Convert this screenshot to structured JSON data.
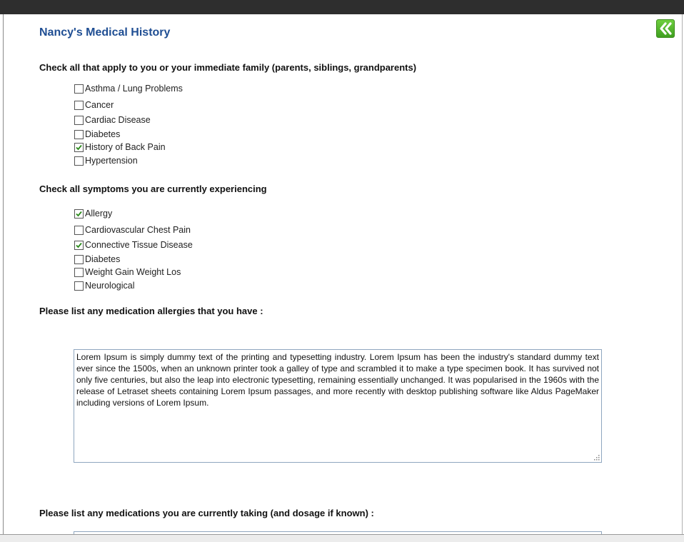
{
  "page": {
    "title": "Nancy's Medical History"
  },
  "back_button": {
    "icon": "double-chevron-left-icon",
    "color": "#4caf2a"
  },
  "family_history": {
    "heading": "Check all that apply to you or your immediate family (parents, siblings, grandparents)",
    "items": [
      {
        "label": "Asthma / Lung Problems",
        "checked": false
      },
      {
        "label": "Cancer",
        "checked": false
      },
      {
        "label": "Cardiac Disease",
        "checked": false
      },
      {
        "label": "Diabetes",
        "checked": false
      },
      {
        "label": "History of Back Pain",
        "checked": true
      },
      {
        "label": "Hypertension",
        "checked": false
      }
    ]
  },
  "symptoms": {
    "heading": "Check all symptoms you are currently experiencing",
    "items": [
      {
        "label": "Allergy",
        "checked": true
      },
      {
        "label": "Cardiovascular Chest Pain",
        "checked": false
      },
      {
        "label": "Connective Tissue Disease",
        "checked": true
      },
      {
        "label": "Diabetes",
        "checked": false
      },
      {
        "label": "Weight Gain Weight Los",
        "checked": false
      },
      {
        "label": "Neurological",
        "checked": false
      }
    ]
  },
  "allergies": {
    "heading": "Please list any medication allergies that you have :",
    "value": "Lorem Ipsum is simply dummy text of the printing and typesetting industry. Lorem Ipsum has been the industry's standard dummy text ever since the 1500s, when an unknown printer took a galley of type and scrambled it to make a type specimen book. It has survived not only five centuries, but also the leap into electronic typesetting, remaining essentially unchanged. It was popularised in the 1960s with the release of Letraset sheets containing Lorem Ipsum passages, and more recently with desktop publishing software like Aldus PageMaker including versions of Lorem Ipsum."
  },
  "medications": {
    "heading": "Please list any medications you are currently taking (and dosage if known) :",
    "value": ""
  }
}
